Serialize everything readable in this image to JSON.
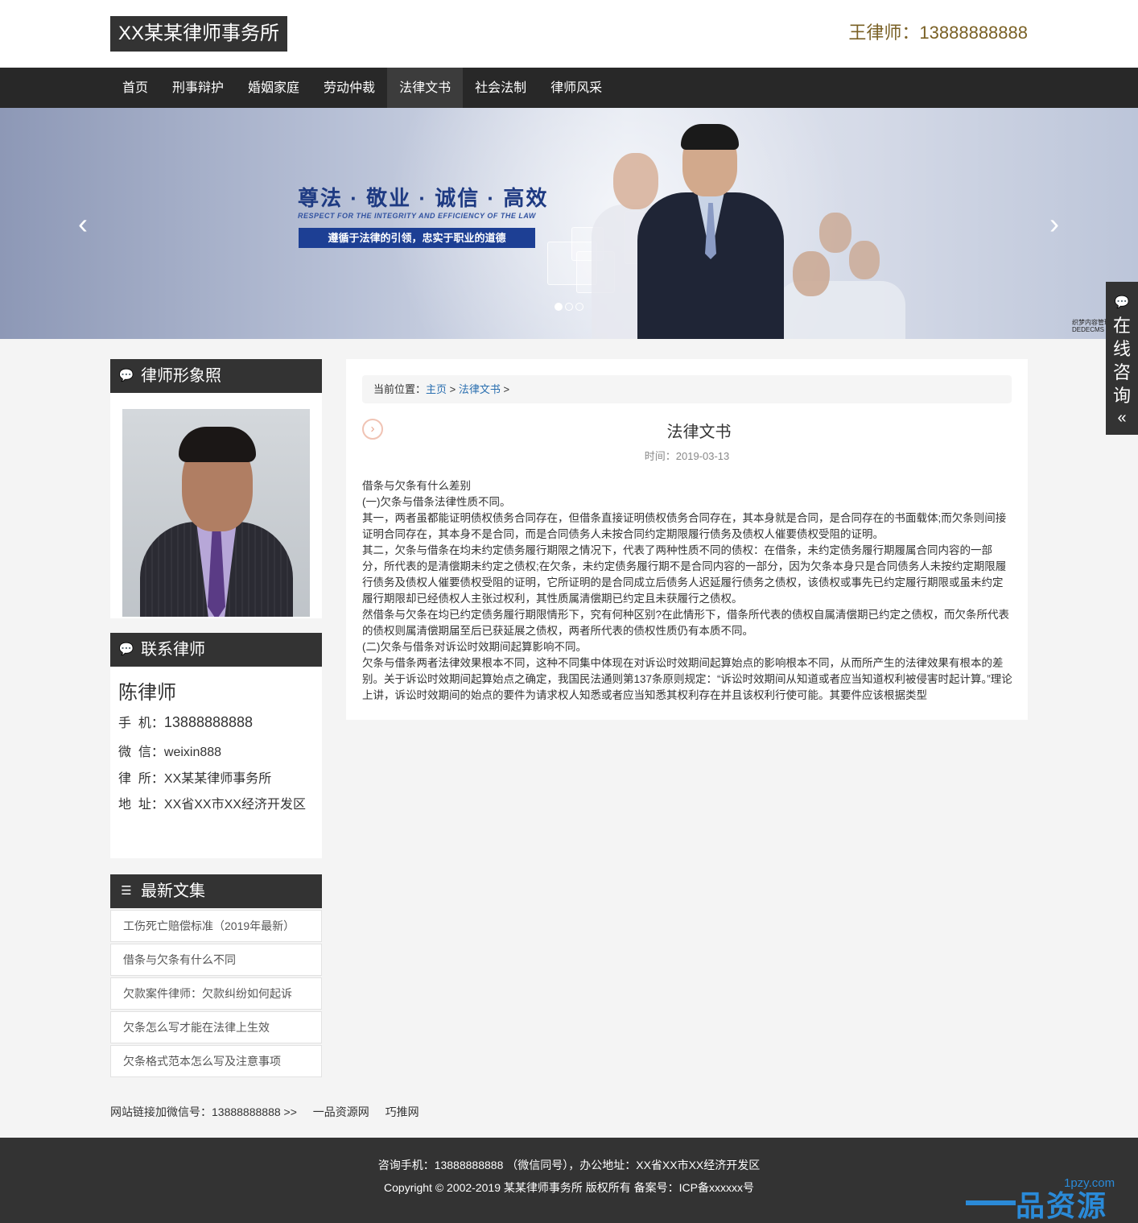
{
  "header": {
    "logo": "XX某某律师事务所",
    "hotline": "王律师：13888888888"
  },
  "nav": {
    "items": [
      "首页",
      "刑事辩护",
      "婚姻家庭",
      "劳动仲裁",
      "法律文书",
      "社会法制",
      "律师风采"
    ],
    "active_index": 4
  },
  "banner": {
    "title": "尊法 · 敬业 · 诚信 · 高效",
    "subtitle": "RESPECT FOR THE INTEGRITY AND EFFICIENCY OF THE LAW",
    "bar_text": "遵循于法律的引领，忠实于职业的道德",
    "prev": "‹",
    "next": "›",
    "active_slide": 1,
    "slide_count": 3,
    "corner_mark": "织梦内容管理 DEDECMS"
  },
  "sidebar": {
    "photo_title": "律师形象照",
    "contact_title": "联系律师",
    "contact": {
      "name": "陈律师",
      "phone_label": "手  机：",
      "phone": "13888888888",
      "wechat_label": "微  信：",
      "wechat": "weixin888",
      "firm_label": "律  所：",
      "firm": "XX某某律师事务所",
      "address_label": "地  址：",
      "address": "XX省XX市XX经济开发区"
    },
    "news_title": "最新文集",
    "news": [
      "工伤死亡赔偿标准（2019年最新）",
      "借条与欠条有什么不同",
      "欠款案件律师：欠款纠纷如何起诉",
      "欠条怎么写才能在法律上生效",
      "欠条格式范本怎么写及注意事项"
    ]
  },
  "breadcrumb": {
    "label": "当前位置：",
    "home": "主页",
    "sep": ">",
    "section": "法律文书",
    "tail": ">"
  },
  "article": {
    "title": "法律文书",
    "date": "时间：2019-03-13",
    "paragraphs": [
      "借条与欠条有什么差别",
      "(一)欠条与借条法律性质不同。",
      "其一，两者虽都能证明债权债务合同存在，但借条直接证明债权债务合同存在，其本身就是合同，是合同存在的书面载体;而欠条则间接证明合同存在，其本身不是合同，而是合同债务人未按合同约定期限履行债务及债权人催要债权受阻的证明。",
      "其二，欠条与借条在均未约定债务履行期限之情况下，代表了两种性质不同的债权：在借条，未约定债务履行期履属合同内容的一部分，所代表的是清偿期未约定之债权;在欠条，未约定债务履行期不是合同内容的一部分，因为欠条本身只是合同债务人未按约定期限履行债务及债权人催要债权受阻的证明，它所证明的是合同成立后债务人迟延履行债务之债权，该债权或事先已约定履行期限或虽未约定履行期限却已经债权人主张过权利，其性质属清偿期已约定且未获履行之债权。",
      "然借条与欠条在均已约定债务履行期限情形下，究有何种区别?在此情形下，借条所代表的债权自属清偿期已约定之债权，而欠条所代表的债权则属清偿期届至后已获延展之债权，两者所代表的债权性质仍有本质不同。",
      "(二)欠条与借条对诉讼时效期间起算影响不同。",
      "欠条与借条两者法律效果根本不同，这种不同集中体现在对诉讼时效期间起算始点的影响根本不同，从而所产生的法律效果有根本的差别。关于诉讼时效期间起算始点之确定，我国民法通则第137条原则规定：“诉讼时效期间从知道或者应当知道权利被侵害时起计算。”理论上讲，诉讼时效期间的始点的要件为请求权人知悉或者应当知悉其权利存在并且该权利行使可能。其要件应该根据类型"
    ]
  },
  "links": {
    "label": "网站链接加微信号：13888888888 >>",
    "items": [
      "一品资源网",
      "巧推网"
    ]
  },
  "footer": {
    "line1": "咨询手机：13888888888 （微信同号），办公地址：XX省XX市XX经济开发区",
    "line2": "Copyright © 2002-2019 某某律师事务所 版权所有 备案号：ICP备xxxxxx号",
    "watermark_text": "资源网",
    "watermark_char": "品",
    "watermark_domain": "1pzy.com"
  },
  "consult": {
    "text": "在线咨询",
    "chevron": "«"
  },
  "colors": {
    "dark": "#333333",
    "nav_bg": "#282828",
    "hotline": "#7a6126",
    "banner_bar": "#1d3f94",
    "link_blue": "#2a6fb0"
  }
}
